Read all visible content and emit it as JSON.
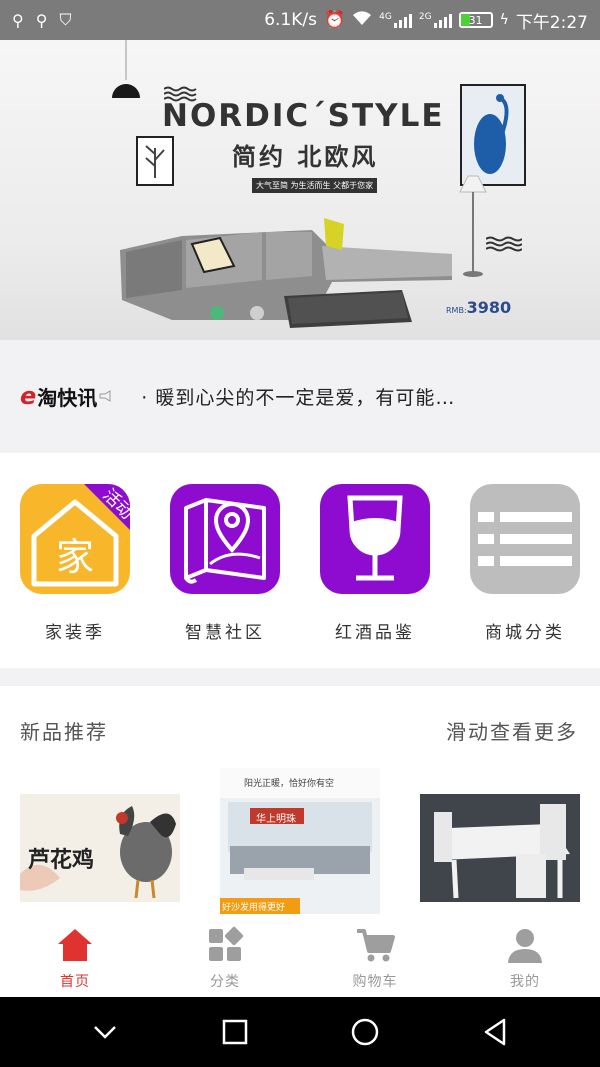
{
  "status_bar": {
    "speed": "6.1K/s",
    "network_4g": "4G",
    "network_2g": "2G",
    "battery": "31",
    "time": "下午2:27"
  },
  "banner": {
    "title": "NORDIC´STYLE",
    "subtitle": "简约 北欧风",
    "tagline": "大气至简 为生活而生 父都于您家",
    "price_prefix": "RMB:",
    "price": "3980"
  },
  "news": {
    "logo_e": "e",
    "logo_text": "淘快讯",
    "text": "· 暖到心尖的不一定是爱，有可能…"
  },
  "categories": [
    {
      "label": "家装季",
      "icon": "home-icon",
      "badge": "活动",
      "glyph": "家",
      "color": "#f8b62b"
    },
    {
      "label": "智慧社区",
      "icon": "map-pin-icon",
      "color": "#8e0ccf"
    },
    {
      "label": "红酒品鉴",
      "icon": "wine-glass-icon",
      "color": "#8e0ccf"
    },
    {
      "label": "商城分类",
      "icon": "list-icon",
      "color": "#bdbdbd"
    }
  ],
  "new_products": {
    "title": "新品推荐",
    "more": "滑动查看更多",
    "items": [
      {
        "caption": "芦花鸡",
        "icon": "rooster-image"
      },
      {
        "caption": "阳光正暖，恰好你有空",
        "brand": "华上明珠",
        "footer": "好沙发用得更好",
        "icon": "sofa-showroom-image"
      },
      {
        "caption": "",
        "icon": "dining-table-image"
      }
    ]
  },
  "tabs": [
    {
      "label": "首页",
      "icon": "home-icon",
      "active": true
    },
    {
      "label": "分类",
      "icon": "category-icon",
      "active": false
    },
    {
      "label": "购物车",
      "icon": "cart-icon",
      "active": false
    },
    {
      "label": "我的",
      "icon": "user-icon",
      "active": false
    }
  ],
  "colors": {
    "accent": "#e0322e",
    "purple": "#8e0ccf",
    "orange": "#f8b62b",
    "grey": "#bdbdbd"
  }
}
